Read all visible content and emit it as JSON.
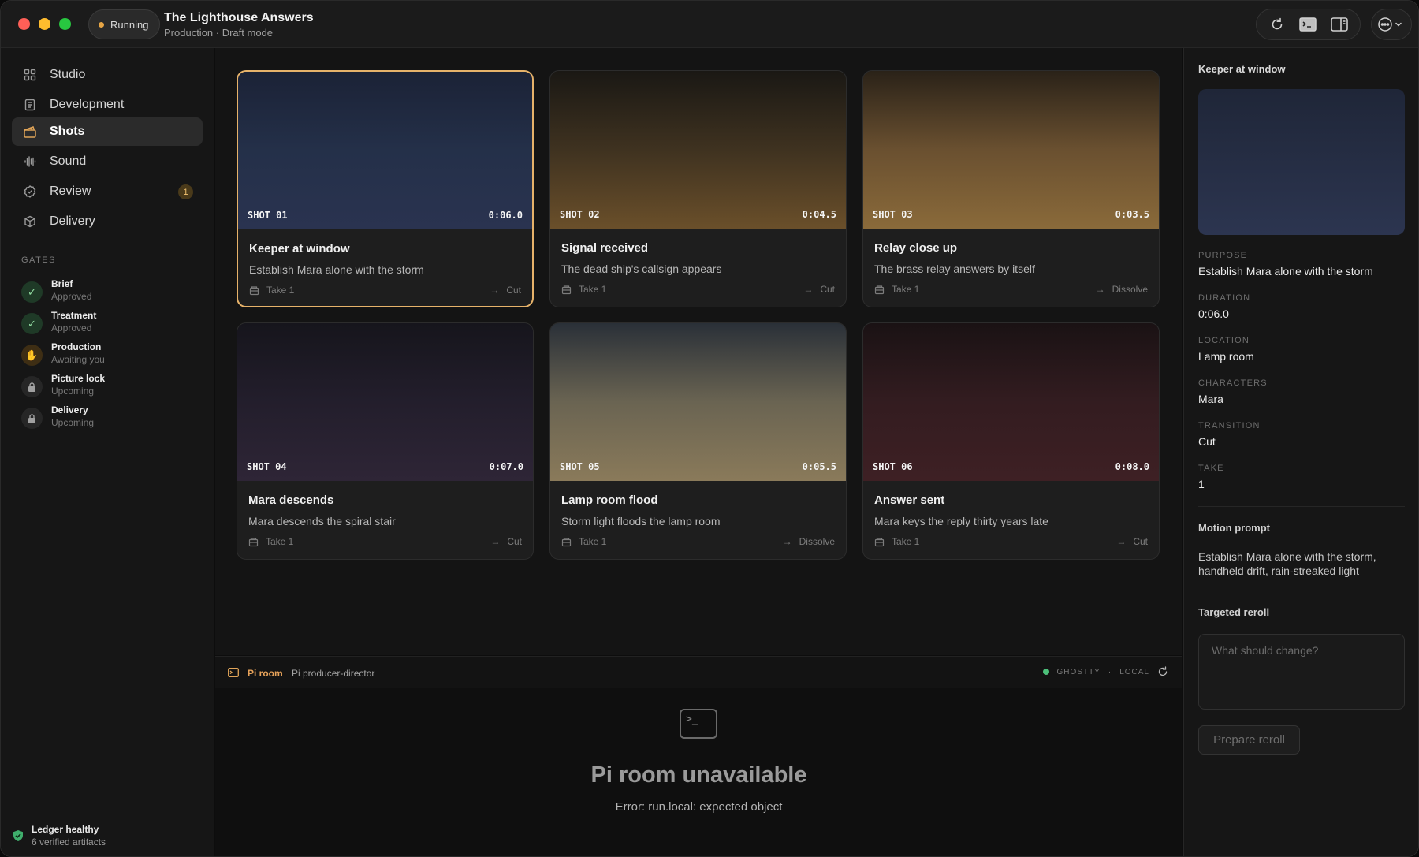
{
  "window": {
    "status": "Running",
    "title": "The Lighthouse Answers",
    "subtitle": "Production · Draft mode",
    "status_color": "#e6a545"
  },
  "toolbar": {
    "icons": [
      "refresh-icon",
      "terminal-icon",
      "sidebar-right-icon",
      "more-options-icon"
    ]
  },
  "sidebar": {
    "nav": [
      {
        "label": "Studio",
        "icon": "grid-icon"
      },
      {
        "label": "Development",
        "icon": "document-icon"
      },
      {
        "label": "Shots",
        "icon": "clapper-icon",
        "active": true
      },
      {
        "label": "Sound",
        "icon": "waveform-icon"
      },
      {
        "label": "Review",
        "icon": "check-badge-icon",
        "badge": "1"
      },
      {
        "label": "Delivery",
        "icon": "package-icon"
      }
    ],
    "gates_label": "GATES",
    "gates": [
      {
        "name": "Brief",
        "status": "Approved",
        "state": "approved"
      },
      {
        "name": "Treatment",
        "status": "Approved",
        "state": "approved"
      },
      {
        "name": "Production",
        "status": "Awaiting you",
        "state": "awaiting"
      },
      {
        "name": "Picture lock",
        "status": "Upcoming",
        "state": "locked"
      },
      {
        "name": "Delivery",
        "status": "Upcoming",
        "state": "locked"
      }
    ],
    "ledger": {
      "title": "Ledger healthy",
      "detail": "6 verified artifacts"
    }
  },
  "shots": [
    {
      "id": "SHOT 01",
      "duration": "0:06.0",
      "title": "Keeper at window",
      "desc": "Establish Mara alone with the storm",
      "take": "Take 1",
      "transition": "Cut",
      "gradient": [
        "#1b2236",
        "#243049",
        "#2a3350"
      ]
    },
    {
      "id": "SHOT 02",
      "duration": "0:04.5",
      "title": "Signal received",
      "desc": "The dead ship's callsign appears",
      "take": "Take 1",
      "transition": "Cut",
      "gradient": [
        "#1a1814",
        "#3f3220",
        "#6a4f2a"
      ]
    },
    {
      "id": "SHOT 03",
      "duration": "0:03.5",
      "title": "Relay close up",
      "desc": "The brass relay answers by itself",
      "take": "Take 1",
      "transition": "Dissolve",
      "gradient": [
        "#2a2218",
        "#6a5030",
        "#8a6a3a"
      ]
    },
    {
      "id": "SHOT 04",
      "duration": "0:07.0",
      "title": "Mara descends",
      "desc": "Mara descends the spiral stair",
      "take": "Take 1",
      "transition": "Cut",
      "gradient": [
        "#16151c",
        "#231e2c",
        "#2e2536"
      ]
    },
    {
      "id": "SHOT 05",
      "duration": "0:05.5",
      "title": "Lamp room flood",
      "desc": "Storm light floods the lamp room",
      "take": "Take 1",
      "transition": "Dissolve",
      "gradient": [
        "#2a3038",
        "#6a6452",
        "#8a7a5a"
      ]
    },
    {
      "id": "SHOT 06",
      "duration": "0:08.0",
      "title": "Answer sent",
      "desc": "Mara keys the reply thirty years late",
      "take": "Take 1",
      "transition": "Cut",
      "gradient": [
        "#1a1214",
        "#331c20",
        "#3e2024"
      ]
    }
  ],
  "pi_room": {
    "label": "Pi room",
    "subtitle": "Pi producer-director",
    "engine": "GHOSTTY",
    "separator": "·",
    "mode": "LOCAL",
    "title": "Pi room unavailable",
    "error": "Error: run.local: expected object"
  },
  "detail": {
    "title": "Keeper at window",
    "fields": [
      {
        "key": "PURPOSE",
        "value": "Establish Mara alone with the storm"
      },
      {
        "key": "DURATION",
        "value": "0:06.0"
      },
      {
        "key": "LOCATION",
        "value": "Lamp room"
      },
      {
        "key": "CHARACTERS",
        "value": "Mara"
      },
      {
        "key": "TRANSITION",
        "value": "Cut"
      },
      {
        "key": "TAKE",
        "value": "1"
      }
    ],
    "motion_prompt_label": "Motion prompt",
    "motion_prompt": "Establish Mara alone with the storm, handheld drift, rain-streaked light",
    "reroll_label": "Targeted reroll",
    "reroll_placeholder": "What should change?",
    "reroll_button": "Prepare reroll"
  }
}
